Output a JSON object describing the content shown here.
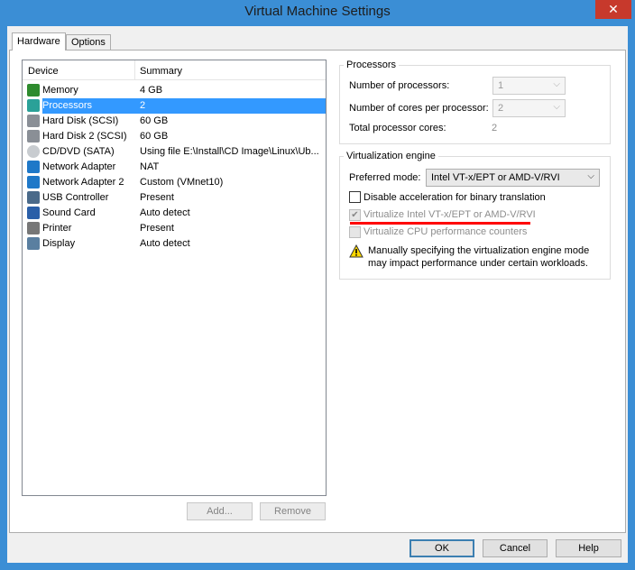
{
  "window": {
    "title": "Virtual Machine Settings",
    "close": "✕"
  },
  "tabs": [
    {
      "label": "Hardware"
    },
    {
      "label": "Options"
    }
  ],
  "device_list": {
    "headers": {
      "device": "Device",
      "summary": "Summary"
    },
    "rows": [
      {
        "device": "Memory",
        "summary": "4 GB",
        "icon": "memory-icon"
      },
      {
        "device": "Processors",
        "summary": "2",
        "icon": "processor-icon"
      },
      {
        "device": "Hard Disk (SCSI)",
        "summary": "60 GB",
        "icon": "hard-disk-icon"
      },
      {
        "device": "Hard Disk 2 (SCSI)",
        "summary": "60 GB",
        "icon": "hard-disk-icon"
      },
      {
        "device": "CD/DVD (SATA)",
        "summary": "Using file E:\\Install\\CD Image\\Linux\\Ub...",
        "icon": "cd-dvd-icon"
      },
      {
        "device": "Network Adapter",
        "summary": "NAT",
        "icon": "network-icon"
      },
      {
        "device": "Network Adapter 2",
        "summary": "Custom (VMnet10)",
        "icon": "network-icon"
      },
      {
        "device": "USB Controller",
        "summary": "Present",
        "icon": "usb-icon"
      },
      {
        "device": "Sound Card",
        "summary": "Auto detect",
        "icon": "sound-icon"
      },
      {
        "device": "Printer",
        "summary": "Present",
        "icon": "printer-icon"
      },
      {
        "device": "Display",
        "summary": "Auto detect",
        "icon": "display-icon"
      }
    ],
    "selected_index": 1
  },
  "list_buttons": {
    "add": "Add...",
    "remove": "Remove"
  },
  "processors": {
    "legend": "Processors",
    "num_label": "Number of processors:",
    "num_value": "1",
    "cores_label": "Number of cores per processor:",
    "cores_value": "2",
    "total_label": "Total processor cores:",
    "total_value": "2"
  },
  "virtualization": {
    "legend": "Virtualization engine",
    "mode_label": "Preferred mode:",
    "mode_value": "Intel VT-x/EPT or AMD-V/RVI",
    "disable_accel": "Disable acceleration for binary translation",
    "virtualize_vtx": "Virtualize Intel VT-x/EPT or AMD-V/RVI",
    "virtualize_cpu": "Virtualize CPU performance counters",
    "warning_line1": "Manually specifying the virtualization engine mode",
    "warning_line2": "may impact performance under certain workloads."
  },
  "footer": {
    "ok": "OK",
    "cancel": "Cancel",
    "help": "Help"
  },
  "colors": {
    "selection": "#3399ff",
    "title_bar": "#3b8ed5",
    "highlight_underline": "#ff0000"
  }
}
